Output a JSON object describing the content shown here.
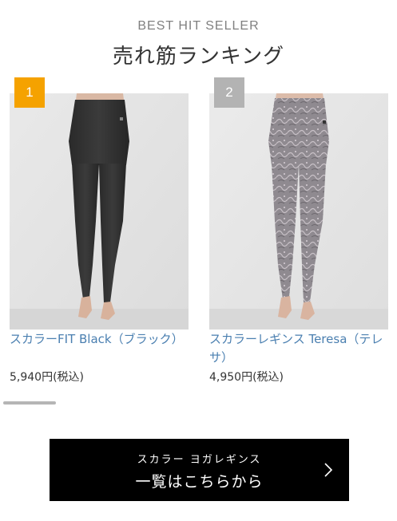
{
  "section": {
    "eyebrow": "BEST HIT SELLER",
    "title": "売れ筋ランキング"
  },
  "products": [
    {
      "rank": "1",
      "rank_color": "#f5a200",
      "name": "スカラーFIT Black（ブラック）",
      "price": "5,940円(税込)",
      "image": "black-leggings-photo"
    },
    {
      "rank": "2",
      "rank_color": "#b3b3b3",
      "name": "スカラーレギンス Teresa（テレサ）",
      "price": "4,950円(税込)",
      "image": "grey-patterned-leggings-photo"
    }
  ],
  "cta": {
    "sub_label": "スカラー ヨガレギンス",
    "main_label": "一覧はこちらから",
    "icon": "chevron-right-icon"
  },
  "colors": {
    "link": "#4a7fb0",
    "cta_background": "#000000"
  }
}
